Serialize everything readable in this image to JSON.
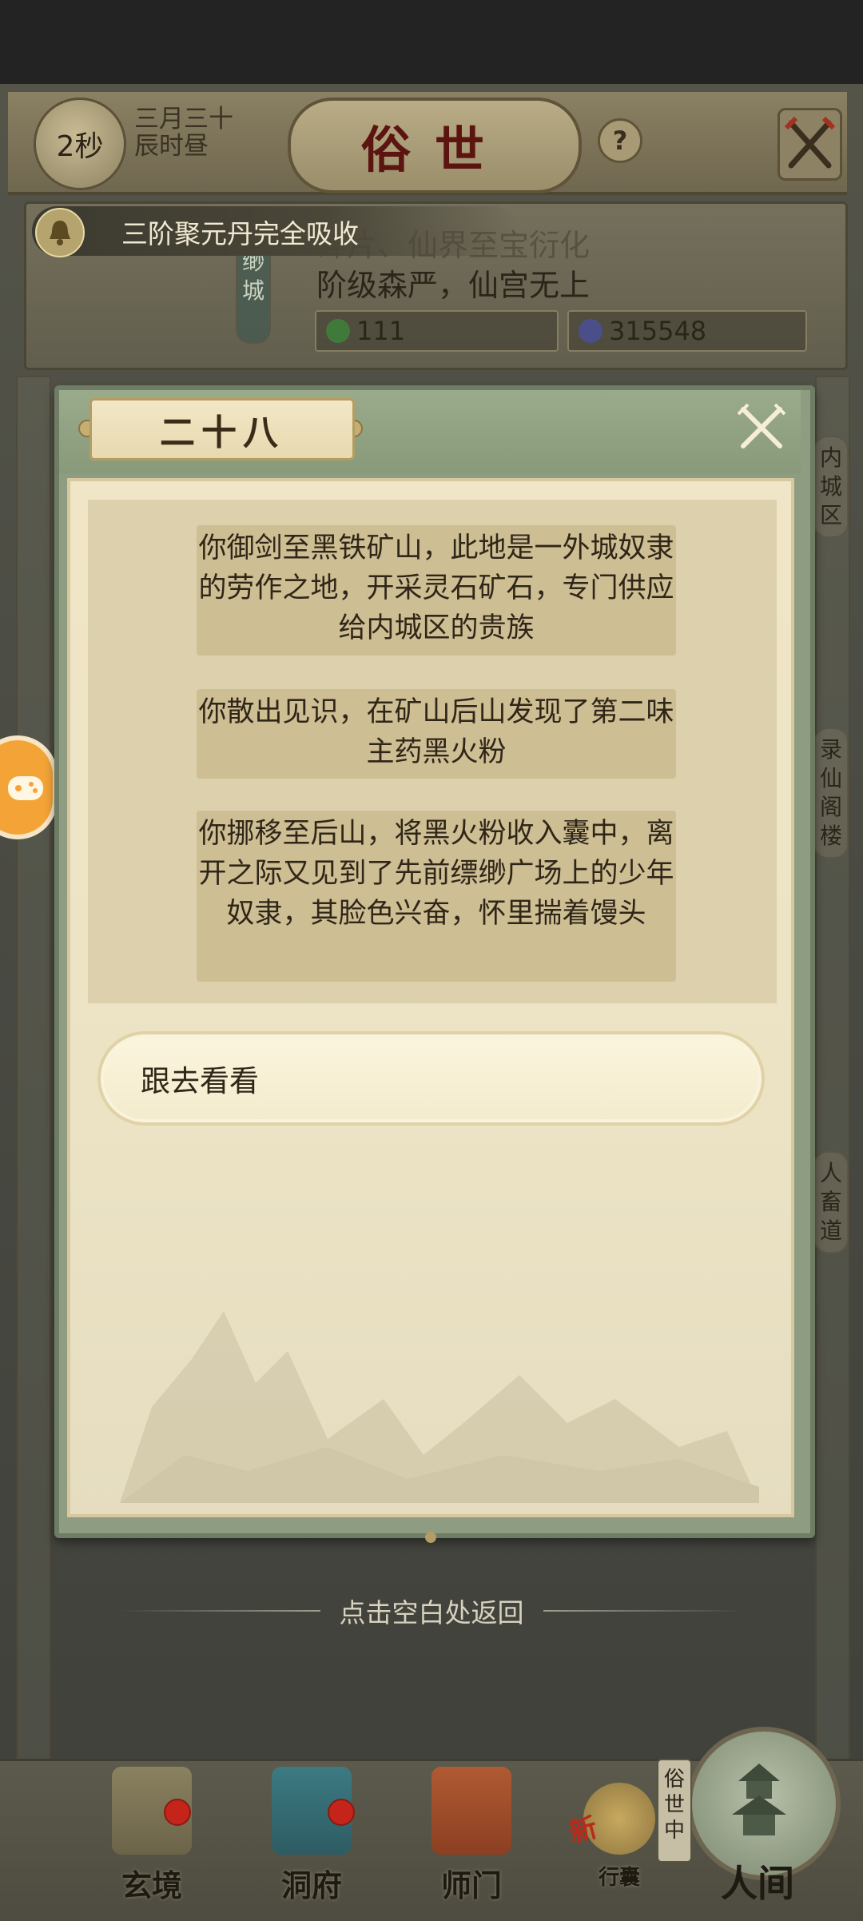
{
  "header": {
    "timer": "2秒",
    "date_line1": "三月三十",
    "date_line2": "辰时昼",
    "title": "俗世",
    "help": "?"
  },
  "notice": {
    "bell_text": "三阶聚元丹完全吸收",
    "bg_line1": "碎片、仙界至宝衍化",
    "bg_line2": "阶级森严，仙宫无上",
    "stat_left": "111",
    "stat_right": "315548"
  },
  "side_labels": {
    "left_banner": "缈城",
    "right_1": "内城区",
    "right_2": "录仙阁楼",
    "right_3": "人畜道"
  },
  "dialog": {
    "title": "二十八",
    "story": [
      "你御剑至黑铁矿山，此地是一外城奴隶的劳作之地，开采灵石矿石，专门供应给内城区的贵族",
      "你散出见识，在矿山后山发现了第二味主药黑火粉",
      "你挪移至后山，将黑火粉收入囊中，离开之际又见到了先前缥缈广场上的少年奴隶，其脸色兴奋，怀里揣着馒头"
    ],
    "choice": "跟去看看"
  },
  "hint": "点击空白处返回",
  "nav": {
    "items": [
      "玄境",
      "洞府",
      "师门",
      "行囊"
    ],
    "world_tag": "俗世中",
    "world_label": "人间",
    "new_badge": "新"
  },
  "colors": {
    "dialog_frame": "#8e9c82",
    "paper": "#f0e6c7",
    "title_red": "#5b1410",
    "orange_button": "#f4a437"
  }
}
